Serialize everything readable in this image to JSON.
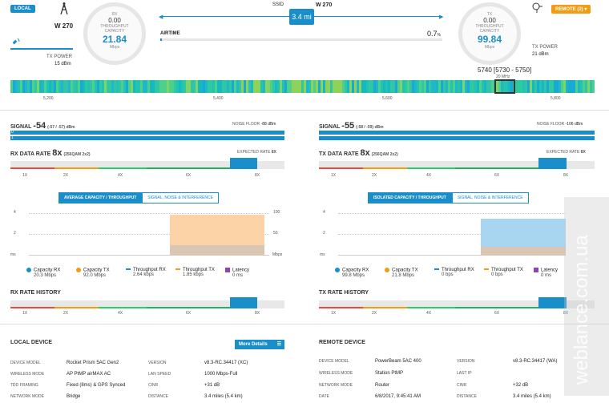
{
  "header": {
    "local_badge": "LOCAL",
    "local_name": "W 270",
    "ssid_label": "SSID",
    "ssid_value": "W 270",
    "distance": "3.4 mi",
    "remote_badge": "REMOTE (2)",
    "airtime_label": "AIRTIME",
    "airtime_value": "0.7",
    "airtime_unit": "%",
    "airtime_fraction": 0.007
  },
  "local_gauge": {
    "dir": "RX",
    "throughput_val": "0.00",
    "throughput_lbl": "THROUGHPUT",
    "capacity_lbl": "CAPACITY",
    "capacity_val": "21.84",
    "unit": "Mbps",
    "tx_power_lbl": "TX POWER",
    "tx_power_val": "15 dBm"
  },
  "remote_gauge": {
    "dir": "TX",
    "throughput_val": "0.00",
    "throughput_lbl": "THROUGHPUT",
    "capacity_lbl": "CAPACITY",
    "capacity_val": "99.84",
    "unit": "Mbps",
    "tx_power_lbl": "TX POWER",
    "tx_power_val": "21 dBm"
  },
  "spectrum": {
    "channel": "5740 [5730 - 5750]",
    "width": "20 MHz",
    "ticks": [
      "5,200",
      "5,400",
      "5,600",
      "5,800"
    ]
  },
  "local": {
    "signal_lbl": "SIGNAL",
    "signal_val": "-54",
    "signal_sub": "(-57 / -57) dBm",
    "noise_lbl": "NOISE FLOOR",
    "noise_val": "-88 dBm",
    "rate_lbl": "RX DATA RATE",
    "rate_val": "8x",
    "rate_sub": "(256QAM 2x2)",
    "expected_lbl": "EXPECTED RATE",
    "expected_val": "8X",
    "rate_ticks": [
      "1X",
      "2X",
      "4X",
      "6X",
      "8X"
    ],
    "tab_active": "AVERAGE CAPACITY / THROUGHPUT",
    "tab_other": "SIGNAL, NOISE & INTERFERENCE",
    "y_ticks": [
      "4",
      "2",
      "ms"
    ],
    "y2_ticks": [
      "100",
      "50",
      "Mbps"
    ],
    "legend": [
      {
        "name": "Capacity RX",
        "val": "20.3 Mbps",
        "color": "#1a8ecb"
      },
      {
        "name": "Capacity TX",
        "val": "92.0 Mbps",
        "color": "#f39c12"
      },
      {
        "name": "Throughput RX",
        "val": "2.64 kbps",
        "color": "#1a8ecb"
      },
      {
        "name": "Throughput TX",
        "val": "1.85 kbps",
        "color": "#f39c12"
      },
      {
        "name": "Latency",
        "val": "0 ms",
        "color": "#8e44ad"
      }
    ],
    "history_lbl": "RX RATE HISTORY"
  },
  "remote": {
    "signal_lbl": "SIGNAL",
    "signal_val": "-55",
    "signal_sub": "(-58 / -59) dBm",
    "noise_lbl": "NOISE FLOOR",
    "noise_val": "-106 dBm",
    "rate_lbl": "TX DATA RATE",
    "rate_val": "8x",
    "rate_sub": "(256QAM 2x2)",
    "expected_lbl": "EXPECTED RATE",
    "expected_val": "8X",
    "rate_ticks": [
      "1X",
      "2X",
      "4X",
      "6X",
      "8X"
    ],
    "tab_active": "ISOLATED CAPACITY / THROUGHPUT",
    "tab_other": "SIGNAL, NOISE & INTERFERENCE",
    "y_ticks": [
      "4",
      "2",
      "ms"
    ],
    "y2_ticks": [
      "",
      "",
      ""
    ],
    "legend": [
      {
        "name": "Capacity RX",
        "val": "99.8 Mbps",
        "color": "#1a8ecb"
      },
      {
        "name": "Capacity TX",
        "val": "21.8 Mbps",
        "color": "#f39c12"
      },
      {
        "name": "Throughput RX",
        "val": "0 bps",
        "color": "#1a8ecb"
      },
      {
        "name": "Throughput TX",
        "val": "0 bps",
        "color": "#f39c12"
      },
      {
        "name": "Latency",
        "val": "0 ms",
        "color": "#8e44ad"
      }
    ],
    "history_lbl": "TX RATE HISTORY"
  },
  "local_device": {
    "title": "LOCAL DEVICE",
    "more": "More Details",
    "rows": [
      {
        "k": "DEVICE MODEL",
        "v": "Rocket Prism 5AC Gen2",
        "k2": "VERSION",
        "v2": "v8.3-RC.34417 (XC)"
      },
      {
        "k": "WIRELESS MODE",
        "v": "AP PtMP airMAX AC",
        "k2": "LAN SPEED",
        "v2": "1000 Mbps-Full"
      },
      {
        "k": "TDD FRAMING",
        "v": "Fixed (8ms) & GPS Synced",
        "k2": "CINR",
        "v2": "+31 dB"
      },
      {
        "k": "NETWORK MODE",
        "v": "Bridge",
        "k2": "DISTANCE",
        "v2": "3.4 miles (5.4 km)"
      }
    ]
  },
  "remote_device": {
    "title": "REMOTE DEVICE",
    "rows": [
      {
        "k": "DEVICE MODEL",
        "v": "PowerBeam 5AC 400",
        "k2": "VERSION",
        "v2": "v8.3-RC.34417 (WA)"
      },
      {
        "k": "WIRELESS MODE",
        "v": "Station PtMP",
        "k2": "LAST IP",
        "v2": ""
      },
      {
        "k": "NETWORK MODE",
        "v": "Router",
        "k2": "CINR",
        "v2": "+32 dB"
      },
      {
        "k": "DATE",
        "v": "6/8/2017, 9:45:41 AM",
        "k2": "DISTANCE",
        "v2": "3.4 miles (5.4 km)"
      }
    ]
  },
  "watermark": "weblance.com.ua"
}
